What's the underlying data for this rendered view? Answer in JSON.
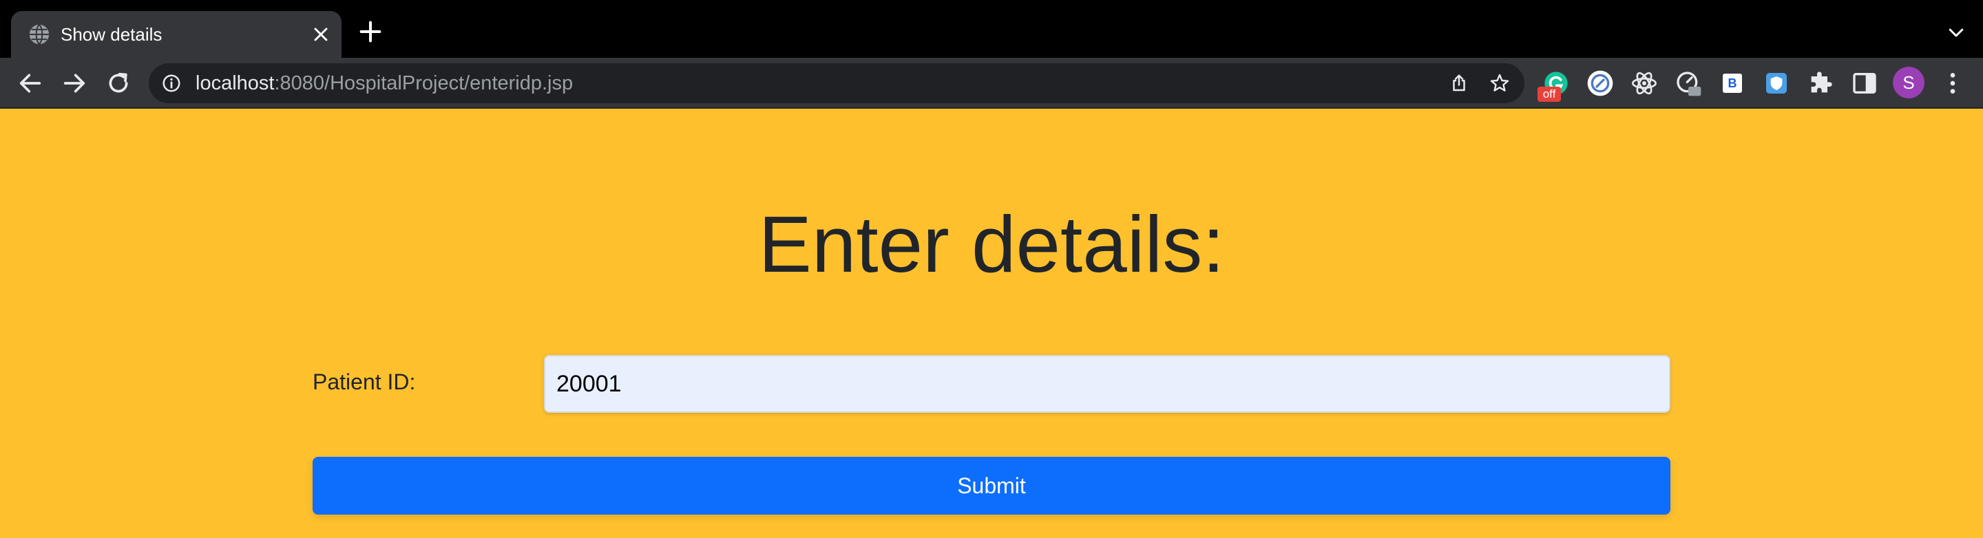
{
  "browser": {
    "tab_title": "Show details",
    "url_host": "localhost",
    "url_rest": ":8080/HospitalProject/enteridp.jsp",
    "extension_badge": "off",
    "ext_b_label": "B",
    "profile_initial": "S"
  },
  "page": {
    "heading": "Enter details:",
    "patient_id_label": "Patient ID:",
    "patient_id_value": "20001",
    "submit_label": "Submit"
  },
  "colors": {
    "page_background": "#ffc02d",
    "submit_button": "#0d6efd",
    "input_background": "#e8f0fe",
    "avatar": "#9a3fb6"
  },
  "icons": [
    "globe-icon",
    "close-icon",
    "plus-icon",
    "chevron-down-icon",
    "back-arrow-icon",
    "forward-arrow-icon",
    "reload-icon",
    "info-icon",
    "share-icon",
    "star-icon",
    "grammarly-icon",
    "extension-circle-icon",
    "react-icon",
    "extension-gauge-icon",
    "bitwarden-icon",
    "shield-icon",
    "puzzle-icon",
    "sidepanel-icon",
    "kebab-menu-icon"
  ]
}
